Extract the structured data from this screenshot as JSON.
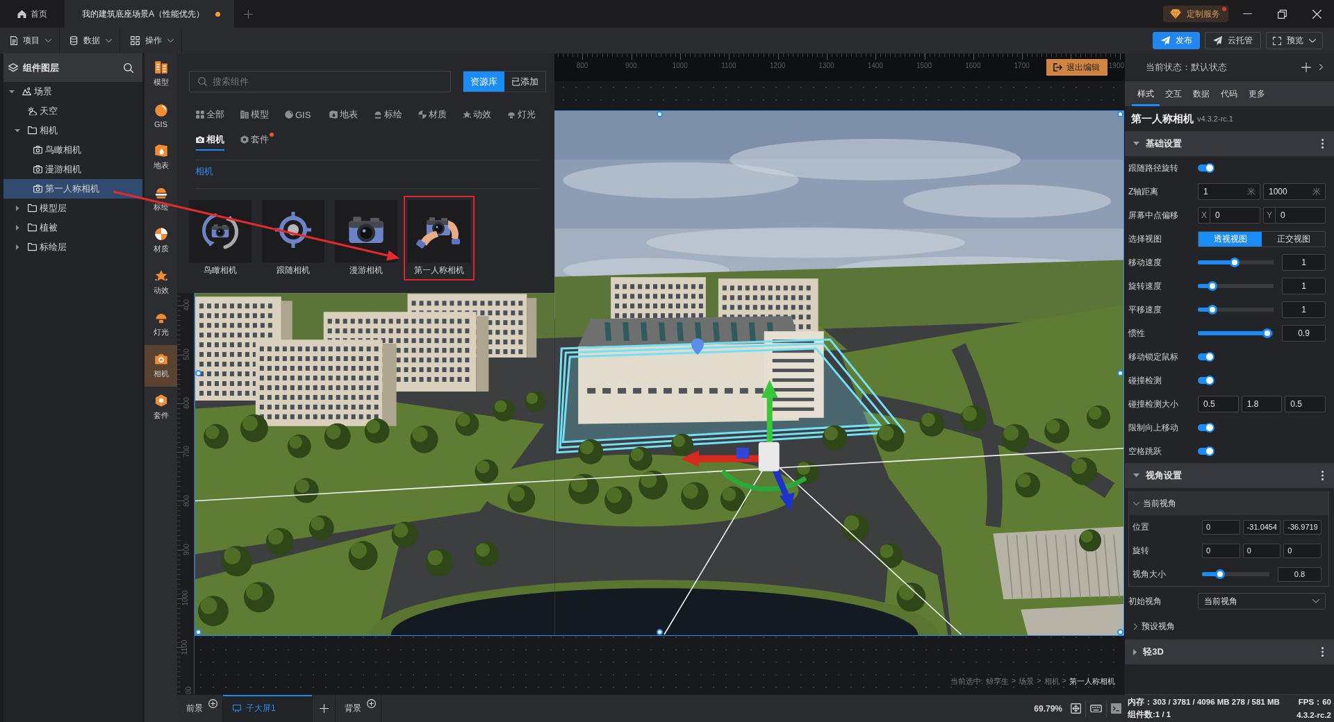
{
  "title_bar": {
    "tabs": [
      {
        "label": "首页",
        "kind": "home",
        "selected": false,
        "unsaved": false
      },
      {
        "label": "我的建筑底座场景A（性能优先）",
        "kind": "document",
        "selected": true,
        "unsaved": true
      }
    ],
    "service": {
      "label": "定制服务",
      "badge": true
    }
  },
  "toolbar": {
    "menus": [
      {
        "label": "项目",
        "kind": "file"
      },
      {
        "label": "数据",
        "kind": "data"
      },
      {
        "label": "操作",
        "kind": "grid"
      }
    ],
    "actions": [
      {
        "label": "发布",
        "kind": "publish"
      },
      {
        "label": "云托管",
        "kind": "hosting"
      },
      {
        "label": "预览",
        "kind": "preview"
      }
    ]
  },
  "layer_panel": {
    "title": "组件图层",
    "tree": [
      {
        "label": "场景",
        "kind": "scene",
        "selected": false,
        "expanded": true,
        "children": [
          {
            "label": "天空",
            "kind": "sky",
            "selected": false
          },
          {
            "label": "相机",
            "kind": "folder",
            "selected": false,
            "expanded": true,
            "children": [
              {
                "label": "鸟瞰相机",
                "kind": "camera",
                "selected": false
              },
              {
                "label": "漫游相机",
                "kind": "camera",
                "selected": false
              },
              {
                "label": "第一人称相机",
                "kind": "camera",
                "selected": true
              }
            ]
          },
          {
            "label": "模型层",
            "kind": "folder",
            "selected": false,
            "expanded": false
          },
          {
            "label": "植被",
            "kind": "folder",
            "selected": false,
            "expanded": false
          },
          {
            "label": "标绘层",
            "kind": "folder",
            "selected": false,
            "expanded": false
          }
        ]
      }
    ]
  },
  "side_bar": {
    "items": [
      {
        "label": "模型",
        "kind": "model",
        "selected": false
      },
      {
        "label": "GIS",
        "kind": "gis",
        "selected": false
      },
      {
        "label": "地表",
        "kind": "terrain",
        "selected": false
      },
      {
        "label": "标绘",
        "kind": "marker",
        "selected": false
      },
      {
        "label": "材质",
        "kind": "material",
        "selected": false
      },
      {
        "label": "动效",
        "kind": "effect",
        "selected": false
      },
      {
        "label": "灯光",
        "kind": "light",
        "selected": false
      },
      {
        "label": "相机",
        "kind": "camera",
        "selected": true
      },
      {
        "label": "套件",
        "kind": "kit",
        "selected": false
      }
    ]
  },
  "component_panel": {
    "search": {
      "placeholder": "搜索组件"
    },
    "sources": [
      {
        "label": "资源库",
        "selected": true
      },
      {
        "label": "已添加",
        "selected": false
      }
    ],
    "categories": [
      {
        "label": "全部",
        "kind": "all",
        "selected": false,
        "badge": false
      },
      {
        "label": "模型",
        "kind": "model",
        "selected": false,
        "badge": false
      },
      {
        "label": "GIS",
        "kind": "gis",
        "selected": false,
        "badge": false
      },
      {
        "label": "地表",
        "kind": "terrain",
        "selected": false,
        "badge": false
      },
      {
        "label": "标绘",
        "kind": "marker",
        "selected": false,
        "badge": false
      },
      {
        "label": "材质",
        "kind": "material",
        "selected": false,
        "badge": false
      },
      {
        "label": "动效",
        "kind": "effect",
        "selected": false,
        "badge": false
      },
      {
        "label": "灯光",
        "kind": "light",
        "selected": false,
        "badge": false
      },
      {
        "label": "相机",
        "kind": "camera",
        "selected": true,
        "badge": false
      },
      {
        "label": "套件",
        "kind": "kit",
        "selected": false,
        "badge": true
      }
    ],
    "group_title": "相机",
    "cards": [
      {
        "label": "鸟瞰相机",
        "kind": "orbit",
        "highlighted": false
      },
      {
        "label": "跟随相机",
        "kind": "follow",
        "highlighted": false
      },
      {
        "label": "漫游相机",
        "kind": "roam",
        "highlighted": false
      },
      {
        "label": "第一人称相机",
        "kind": "first_person",
        "highlighted": true
      }
    ]
  },
  "annotation_arrow": true,
  "canvas": {
    "top_ruler": [
      "800",
      "900",
      "1000",
      "1100",
      "1200",
      "1300",
      "1400",
      "1500",
      "1600",
      "1700",
      "1900"
    ],
    "left_ruler": [
      "400",
      "500",
      "600",
      "700",
      "800",
      "900",
      "1000",
      "1100",
      "00"
    ],
    "exit_button": "退出编辑",
    "selection_path": {
      "prefix": "当前选中:",
      "separator": ">",
      "items": [
        "鲸孪生",
        "场景",
        "相机",
        "第一人称相机"
      ]
    }
  },
  "page_tabs": {
    "tabs": [
      {
        "label": "前景",
        "kind": "layer",
        "selected": false
      },
      {
        "label": "子大屏1",
        "kind": "screen",
        "selected": true
      },
      {
        "label": "背景",
        "kind": "layer",
        "selected": false
      }
    ],
    "zoom": "69.79%"
  },
  "properties": {
    "state": "当前状态：默认状态",
    "tabs": [
      {
        "label": "样式",
        "selected": true
      },
      {
        "label": "交互",
        "selected": false
      },
      {
        "label": "数据",
        "selected": false
      },
      {
        "label": "代码",
        "selected": false
      },
      {
        "label": "更多",
        "selected": false
      }
    ],
    "component": {
      "name": "第一人称相机",
      "version": "v4.3.2-rc.1"
    },
    "sections": [
      {
        "title": "基础设置",
        "expanded": true,
        "fields": [
          {
            "kind": "toggle",
            "label": "跟随路径旋转",
            "on": true
          },
          {
            "kind": "inputs",
            "label": "Z轴距离",
            "inputs": [
              {
                "value": "1",
                "unit": "米"
              },
              {
                "value": "1000",
                "unit": "米"
              }
            ]
          },
          {
            "kind": "inputs",
            "label": "屏幕中点偏移",
            "inputs": [
              {
                "prefix": "X",
                "value": "0"
              },
              {
                "prefix": "Y",
                "value": "0"
              }
            ]
          },
          {
            "kind": "segmented",
            "label": "选择视图",
            "options": [
              {
                "label": "透视视图",
                "selected": true
              },
              {
                "label": "正交视图",
                "selected": false
              }
            ]
          },
          {
            "kind": "slider",
            "label": "移动速度",
            "level": 0.49,
            "value": "1"
          },
          {
            "kind": "slider",
            "label": "旋转速度",
            "level": 0.19,
            "value": "1"
          },
          {
            "kind": "slider",
            "label": "平移速度",
            "level": 0.19,
            "value": "1"
          },
          {
            "kind": "slider",
            "label": "惯性",
            "level": 0.92,
            "value": "0.9"
          },
          {
            "kind": "toggle",
            "label": "移动锁定鼠标",
            "on": true
          },
          {
            "kind": "toggle",
            "label": "碰撞检测",
            "on": true
          },
          {
            "kind": "inputs",
            "label": "碰撞检测大小",
            "inputs": [
              {
                "value": "0.5"
              },
              {
                "value": "1.8"
              },
              {
                "value": "0.5"
              }
            ]
          },
          {
            "kind": "toggle",
            "label": "限制向上移动",
            "on": true
          },
          {
            "kind": "toggle",
            "label": "空格跳跃",
            "on": true
          }
        ]
      },
      {
        "title": "视角设置",
        "expanded": true,
        "fields": [
          {
            "kind": "group",
            "label": "当前视角",
            "expanded": true,
            "fields": [
              {
                "kind": "inputs",
                "label": "位置",
                "inputs": [
                  {
                    "value": "0"
                  },
                  {
                    "value": "-31.0454"
                  },
                  {
                    "value": "-36.9719"
                  }
                ]
              },
              {
                "kind": "inputs",
                "label": "旋转",
                "inputs": [
                  {
                    "value": "0"
                  },
                  {
                    "value": "0"
                  },
                  {
                    "value": "0"
                  }
                ]
              },
              {
                "kind": "slider",
                "label": "视角大小",
                "level": 0.27,
                "value": "0.8"
              }
            ]
          },
          {
            "kind": "select",
            "label": "初始视角",
            "value": "当前视角"
          },
          {
            "kind": "group",
            "label": "预设视角",
            "expanded": false
          }
        ]
      },
      {
        "title": "轻3D",
        "expanded": false
      }
    ]
  },
  "stats": {
    "memory": "内存：303 / 3781 / 4096 MB  278 / 581 MB",
    "fps": "FPS：60",
    "count": "组件数:1 / 1",
    "version": "4.3.2-rc.2"
  }
}
